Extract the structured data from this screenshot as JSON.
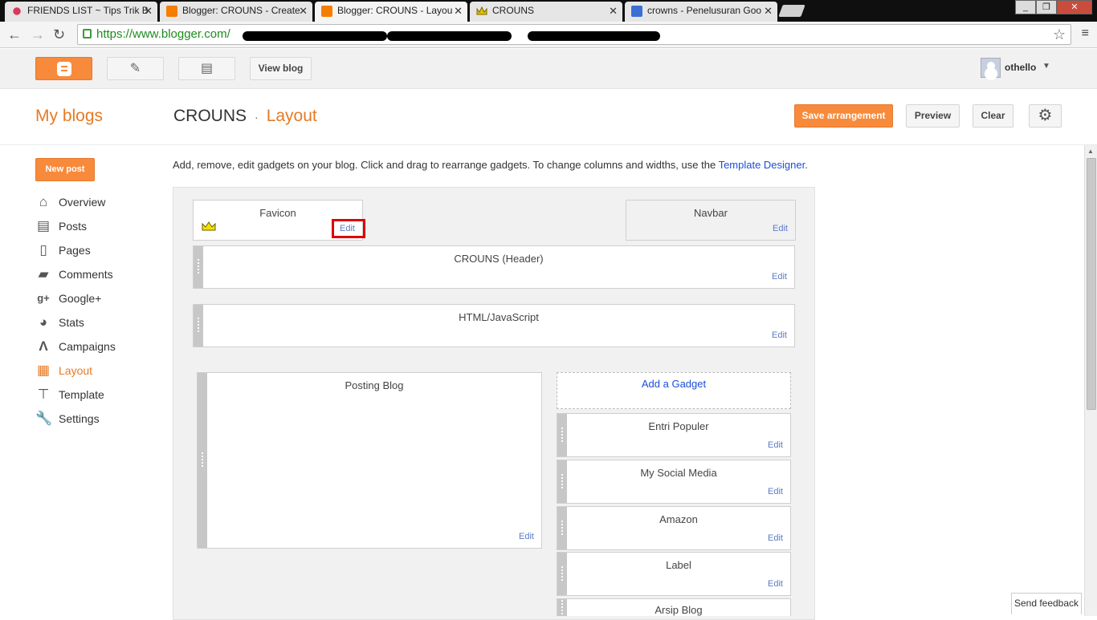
{
  "browser": {
    "tabs": [
      {
        "title": "FRIENDS LIST ~ Tips Trik B",
        "icon": "flower-icon"
      },
      {
        "title": "Blogger: CROUNS - Create",
        "icon": "blogger-icon"
      },
      {
        "title": "Blogger: CROUNS - Layou",
        "icon": "blogger-icon",
        "active": true
      },
      {
        "title": "CROUNS",
        "icon": "crown-icon"
      },
      {
        "title": "crowns - Penelusuran Goo",
        "icon": "google-icon"
      }
    ],
    "url": "https://www.blogger.com/",
    "colors": {
      "url_green": "#1e8c1e",
      "tab_active": "#f4f4f4"
    }
  },
  "topbar": {
    "view_blog_label": "View blog",
    "user_name": "othello"
  },
  "header": {
    "my_blogs": "My blogs",
    "blog_name": "CROUNS",
    "separator": "·",
    "current_page": "Layout",
    "save_label": "Save arrangement",
    "preview_label": "Preview",
    "clear_label": "Clear"
  },
  "sidebar": {
    "new_post_label": "New post",
    "items": [
      {
        "label": "Overview",
        "icon": "home-icon"
      },
      {
        "label": "Posts",
        "icon": "posts-icon"
      },
      {
        "label": "Pages",
        "icon": "pages-icon"
      },
      {
        "label": "Comments",
        "icon": "comments-icon"
      },
      {
        "label": "Google+",
        "icon": "google-plus-icon"
      },
      {
        "label": "Stats",
        "icon": "stats-icon"
      },
      {
        "label": "Campaigns",
        "icon": "campaigns-icon"
      },
      {
        "label": "Layout",
        "icon": "layout-icon",
        "active": true
      },
      {
        "label": "Template",
        "icon": "template-icon"
      },
      {
        "label": "Settings",
        "icon": "settings-icon"
      }
    ]
  },
  "intro": {
    "text": "Add, remove, edit gadgets on your blog. Click and drag to rearrange gadgets. To change columns and widths, use the ",
    "link": "Template Designer",
    "period": "."
  },
  "layout": {
    "edit_label": "Edit",
    "add_gadget_label": "Add a Gadget",
    "gadgets": {
      "favicon": "Favicon",
      "navbar": "Navbar",
      "header": "CROUNS (Header)",
      "html_js": "HTML/JavaScript",
      "posting": "Posting Blog",
      "entri_populer": "Entri Populer",
      "social": "My Social Media",
      "amazon": "Amazon",
      "label": "Label",
      "arsip": "Arsip Blog"
    }
  },
  "feedback_label": "Send feedback",
  "colors": {
    "accent": "#f88a3b",
    "accent_text": "#e67a24",
    "link": "#1c4ed8",
    "highlight": "#e00000"
  }
}
